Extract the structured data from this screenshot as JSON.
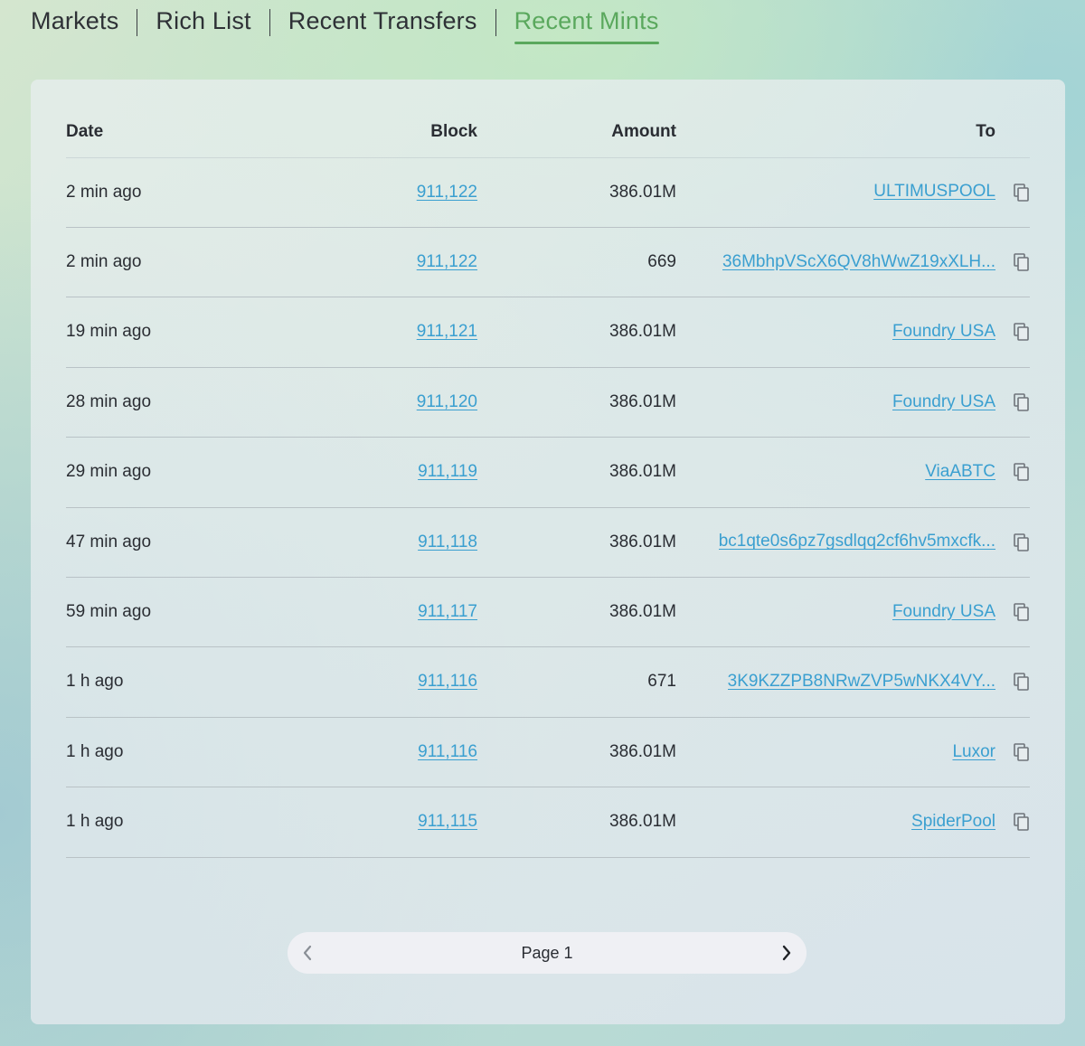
{
  "tabs": [
    {
      "label": "Markets",
      "active": false
    },
    {
      "label": "Rich List",
      "active": false
    },
    {
      "label": "Recent Transfers",
      "active": false
    },
    {
      "label": "Recent Mints",
      "active": true
    }
  ],
  "colors": {
    "accent": "#5aa85d",
    "link": "#3a9fd0"
  },
  "table": {
    "headers": {
      "date": "Date",
      "block": "Block",
      "amount": "Amount",
      "to": "To"
    },
    "rows": [
      {
        "date": "2 min ago",
        "block": "911,122",
        "amount": "386.01M",
        "to": "ULTIMUSPOOL"
      },
      {
        "date": "2 min ago",
        "block": "911,122",
        "amount": "669",
        "to": "36MbhpVScX6QV8hWwZ19xXLH..."
      },
      {
        "date": "19 min ago",
        "block": "911,121",
        "amount": "386.01M",
        "to": "Foundry USA"
      },
      {
        "date": "28 min ago",
        "block": "911,120",
        "amount": "386.01M",
        "to": "Foundry USA"
      },
      {
        "date": "29 min ago",
        "block": "911,119",
        "amount": "386.01M",
        "to": "ViaABTC"
      },
      {
        "date": "47 min ago",
        "block": "911,118",
        "amount": "386.01M",
        "to": "bc1qte0s6pz7gsdlqq2cf6hv5mxcfk..."
      },
      {
        "date": "59 min ago",
        "block": "911,117",
        "amount": "386.01M",
        "to": "Foundry USA"
      },
      {
        "date": "1 h ago",
        "block": "911,116",
        "amount": "671",
        "to": "3K9KZZPB8NRwZVP5wNKX4VY..."
      },
      {
        "date": "1 h ago",
        "block": "911,116",
        "amount": "386.01M",
        "to": "Luxor"
      },
      {
        "date": "1 h ago",
        "block": "911,115",
        "amount": "386.01M",
        "to": "SpiderPool"
      }
    ]
  },
  "pagination": {
    "label": "Page 1",
    "prev_icon": "chevron-left-icon",
    "next_icon": "chevron-right-icon"
  }
}
